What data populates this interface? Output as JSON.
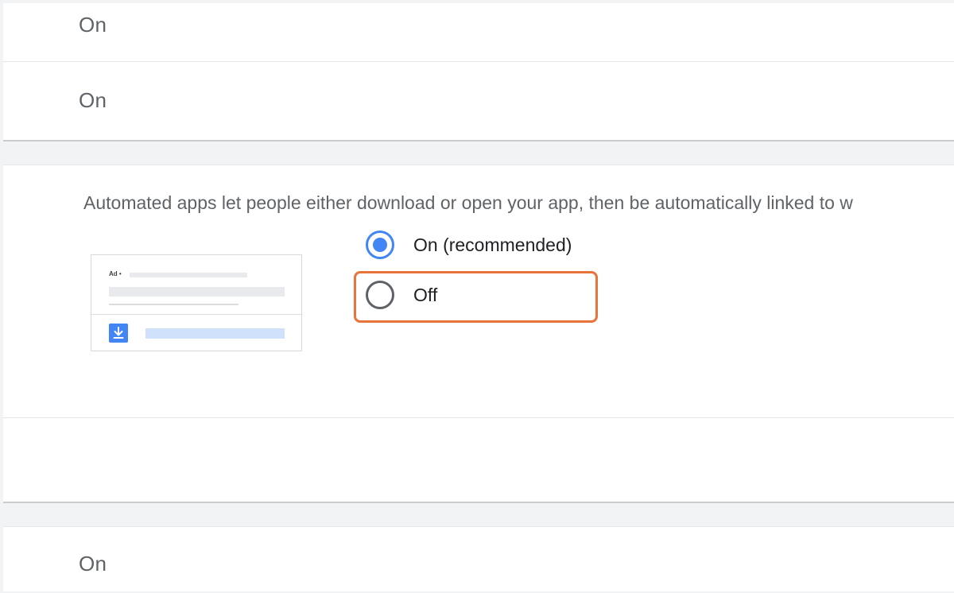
{
  "rows": {
    "top_first_value": "On",
    "top_second_value": "On",
    "bottom_value": "On"
  },
  "automated_apps": {
    "description": "Automated apps let people either download or open your app, then be automatically linked to w",
    "preview": {
      "ad_label": "Ad •",
      "icon": "download-icon"
    },
    "options": [
      {
        "label": "On (recommended)",
        "selected": true
      },
      {
        "label": "Off",
        "selected": false
      }
    ]
  },
  "colors": {
    "accent": "#4285f4",
    "highlight": "#e8743b",
    "text_secondary": "#5f6368",
    "background": "#f1f3f4"
  }
}
